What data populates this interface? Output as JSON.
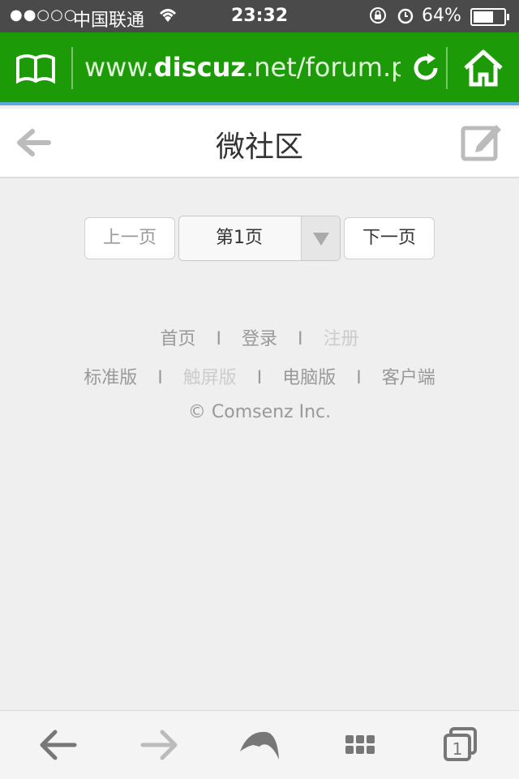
{
  "status_bar": {
    "signal": "●●○○○",
    "carrier": "中国联通",
    "time": "23:32",
    "battery_pct": "64%"
  },
  "browser": {
    "url_prefix": "www.",
    "url_domain": "discuz",
    "url_suffix": ".net/forum.p..."
  },
  "header": {
    "title": "微社区"
  },
  "pager": {
    "prev_label": "上一页",
    "current_page": "第1页",
    "next_label": "下一页"
  },
  "links": {
    "home": "首页",
    "login": "登录",
    "register": "注册",
    "standard": "标准版",
    "touch": "触屏版",
    "desktop": "电脑版",
    "client": "客户端",
    "separator": "I"
  },
  "copyright": "© Comsenz Inc.",
  "colors": {
    "browser_green": "#1d9a07",
    "accent_blue": "#5aa9e6"
  },
  "icons": {
    "book": "book-icon",
    "reload": "reload-icon",
    "home": "home-icon",
    "back": "back-arrow-icon",
    "edit": "edit-icon",
    "dropdown": "dropdown-arrow-icon",
    "toolbar": [
      "back-icon",
      "forward-icon",
      "dolphin-icon",
      "grid-icon",
      "tabs-icon"
    ]
  }
}
